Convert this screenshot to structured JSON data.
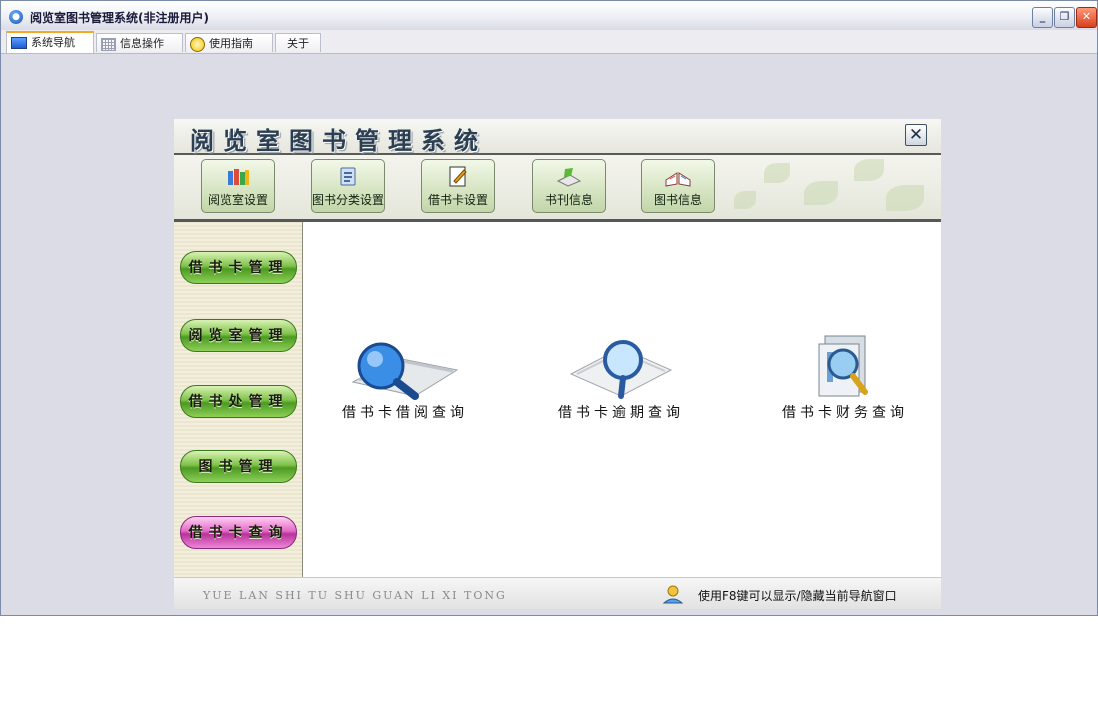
{
  "window": {
    "title": "阅览室图书管理系统(非注册用户)",
    "controls": {
      "minimize": "_",
      "restore": "❐",
      "close": "✕"
    }
  },
  "tabs": [
    {
      "label": "系统导航",
      "icon": "monitor-icon",
      "active": true
    },
    {
      "label": "信息操作",
      "icon": "grid-icon",
      "active": false
    },
    {
      "label": "使用指南",
      "icon": "lamp-icon",
      "active": false
    },
    {
      "label": "关于",
      "icon": "",
      "active": false
    }
  ],
  "panel": {
    "title": "阅览室图书管理系统",
    "close_glyph": "✕"
  },
  "toolbar": [
    {
      "label": "阅览室设置",
      "icon": "books-icon"
    },
    {
      "label": "图书分类设置",
      "icon": "book-category-icon"
    },
    {
      "label": "借书卡设置",
      "icon": "card-edit-icon"
    },
    {
      "label": "书刊信息",
      "icon": "journal-icon"
    },
    {
      "label": "图书信息",
      "icon": "open-book-icon"
    }
  ],
  "sidebar": [
    {
      "label": "借书卡管理",
      "style": "green"
    },
    {
      "label": "阅览室管理",
      "style": "green"
    },
    {
      "label": "借书处管理",
      "style": "green"
    },
    {
      "label": "图书管理",
      "style": "green"
    },
    {
      "label": "借书卡查询",
      "style": "pink"
    }
  ],
  "queries": [
    {
      "label": "借书卡借阅查询",
      "icon": "book-search-icon"
    },
    {
      "label": "借书卡逾期查询",
      "icon": "paper-search-icon"
    },
    {
      "label": "借书卡财务查询",
      "icon": "finance-search-icon"
    }
  ],
  "footer": {
    "left": "YUE LAN SHI TU SHU GUAN LI XI TONG",
    "tip": "使用F8键可以显示/隐藏当前导航窗口"
  },
  "colors": {
    "accent_tab": "#f5a623",
    "sidebar_green": "#4c9a22",
    "sidebar_pink": "#b8329a"
  }
}
